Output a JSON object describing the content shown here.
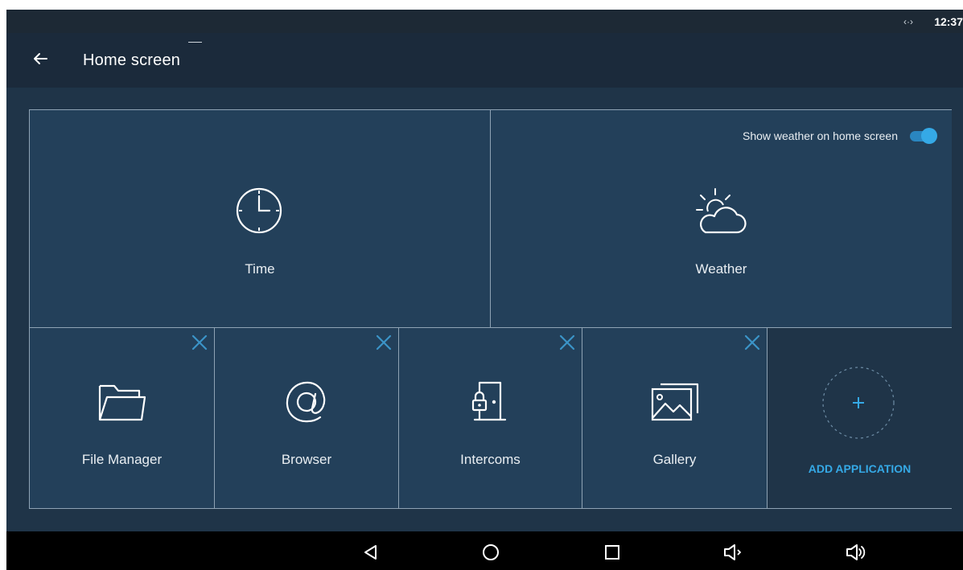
{
  "status_bar": {
    "network_symbol": "‹·›",
    "time": "12:37"
  },
  "app_bar": {
    "back_icon": "arrow-left-icon",
    "title": "Home screen"
  },
  "widgets": {
    "time": {
      "label": "Time",
      "icon": "clock-icon"
    },
    "weather": {
      "label": "Weather",
      "icon": "partly-cloudy-icon",
      "toggle_label": "Show weather on home screen",
      "toggle_on": true
    }
  },
  "apps": [
    {
      "label": "File Manager",
      "icon": "folder-icon",
      "removable": true
    },
    {
      "label": "Browser",
      "icon": "at-sign-icon",
      "removable": true
    },
    {
      "label": "Intercoms",
      "icon": "door-lock-icon",
      "removable": true
    },
    {
      "label": "Gallery",
      "icon": "gallery-icon",
      "removable": true
    }
  ],
  "add_application": {
    "label": "ADD APPLICATION",
    "icon": "plus-icon"
  },
  "nav_bar": {
    "buttons": [
      "back-triangle-icon",
      "home-circle-icon",
      "recents-square-icon",
      "volume-down-icon",
      "volume-up-icon"
    ]
  },
  "colors": {
    "accent": "#35a9e6",
    "close_x": "#3b94c8",
    "tile": "#23405a",
    "background": "#1f3448"
  }
}
